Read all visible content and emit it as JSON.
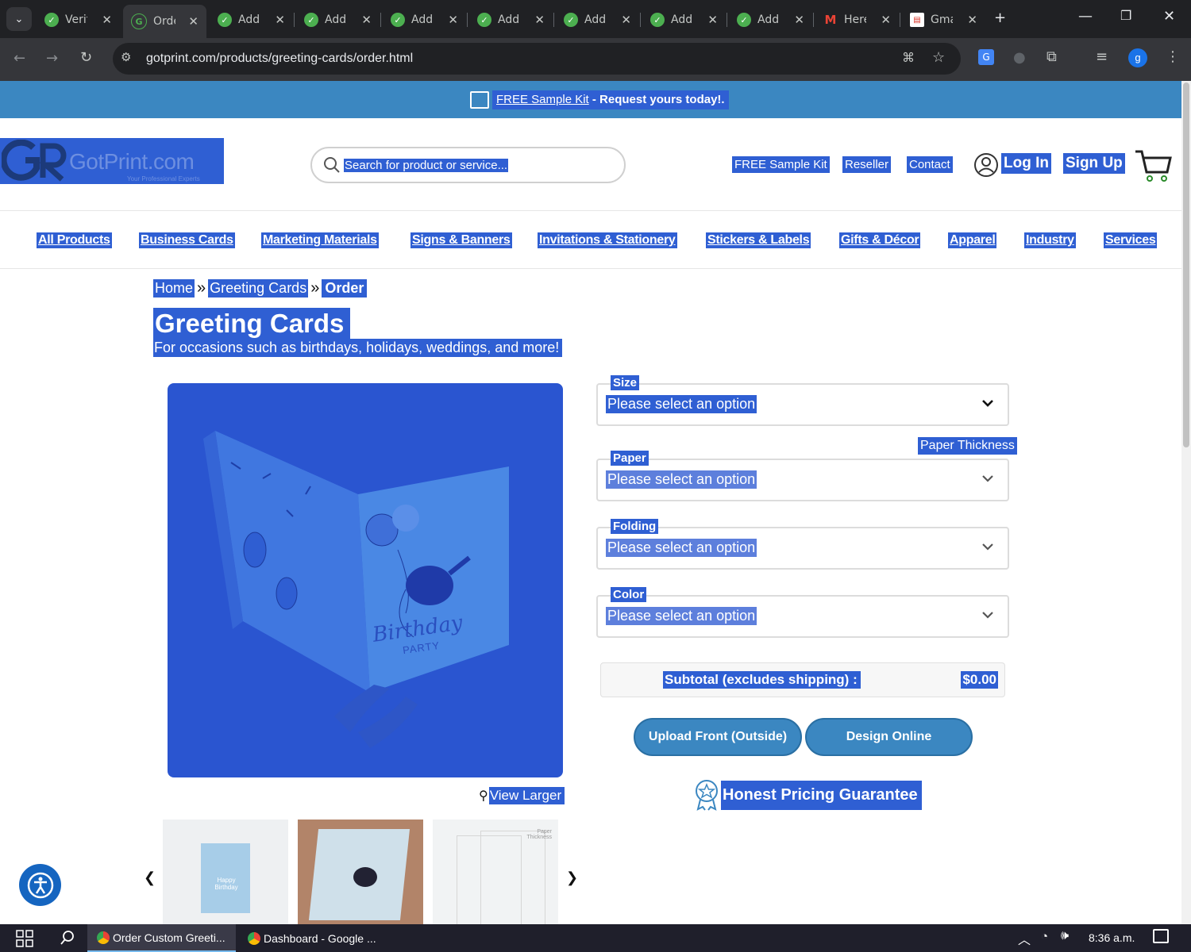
{
  "browser": {
    "tabs": [
      {
        "label": "Verif",
        "icon": "extension-check-icon",
        "active": false
      },
      {
        "label": "Order",
        "icon": "gotprint-favicon",
        "active": true
      },
      {
        "label": "Add",
        "icon": "extension-check-icon",
        "active": false
      },
      {
        "label": "Add",
        "icon": "extension-check-icon",
        "active": false
      },
      {
        "label": "Add",
        "icon": "extension-check-icon",
        "active": false
      },
      {
        "label": "Add",
        "icon": "extension-check-icon",
        "active": false
      },
      {
        "label": "Add",
        "icon": "extension-check-icon",
        "active": false
      },
      {
        "label": "Add",
        "icon": "extension-check-icon",
        "active": false
      },
      {
        "label": "Add",
        "icon": "extension-check-icon",
        "active": false
      },
      {
        "label": "Here",
        "icon": "gmail-icon",
        "active": false
      },
      {
        "label": "Gmail",
        "icon": "sheets-icon",
        "active": false
      }
    ],
    "url": "gotprint.com/products/greeting-cards/order.html",
    "profile_initial": "g"
  },
  "banner": {
    "link": "FREE Sample Kit",
    "text": " - Request yours today!."
  },
  "header": {
    "logo_text": "GotPrint.com",
    "logo_tagline": "Your Professional Experts",
    "search_placeholder": "Search for product or service...",
    "links": {
      "sample_kit": "FREE Sample Kit",
      "reseller": "Reseller",
      "contact": "Contact",
      "login": "Log In",
      "signup": "Sign Up"
    }
  },
  "nav": [
    "All Products",
    "Business Cards",
    "Marketing Materials",
    "Signs & Banners",
    "Invitations & Stationery",
    "Stickers & Labels",
    "Gifts & Décor",
    "Apparel",
    "Industry",
    "Services"
  ],
  "breadcrumb": {
    "home": "Home",
    "sep": "»",
    "category": "Greeting Cards",
    "current": "Order"
  },
  "page": {
    "title": "Greeting Cards",
    "subtitle": "For occasions such as birthdays, holidays, weddings, and more!",
    "view_larger": "View Larger",
    "card_text_1": "Birthday",
    "card_text_2": "PARTY"
  },
  "options": {
    "size": {
      "label": "Size",
      "value": "Please select an option"
    },
    "paper_thickness": "Paper Thickness",
    "paper": {
      "label": "Paper",
      "value": "Please select an option"
    },
    "folding": {
      "label": "Folding",
      "value": "Please select an option"
    },
    "color": {
      "label": "Color",
      "value": "Please select an option"
    }
  },
  "subtotal": {
    "label": "Subtotal (excludes shipping) :",
    "value": "$0.00"
  },
  "buttons": {
    "upload": "Upload Front (Outside)",
    "design": "Design Online"
  },
  "guarantee": "Honest Pricing Guarantee",
  "thumbnails": {
    "thumb1_text": "Happy Birthday",
    "thumb3_text": "Paper Thickness"
  },
  "taskbar": {
    "task1": "Order Custom Greeti...",
    "task2": "Dashboard - Google ...",
    "time": "8:36 a.m."
  },
  "colors": {
    "selection": "#2f5fd3",
    "banner": "#3b87c1",
    "button": "#3b87c1",
    "tab_bar": "#202124"
  }
}
